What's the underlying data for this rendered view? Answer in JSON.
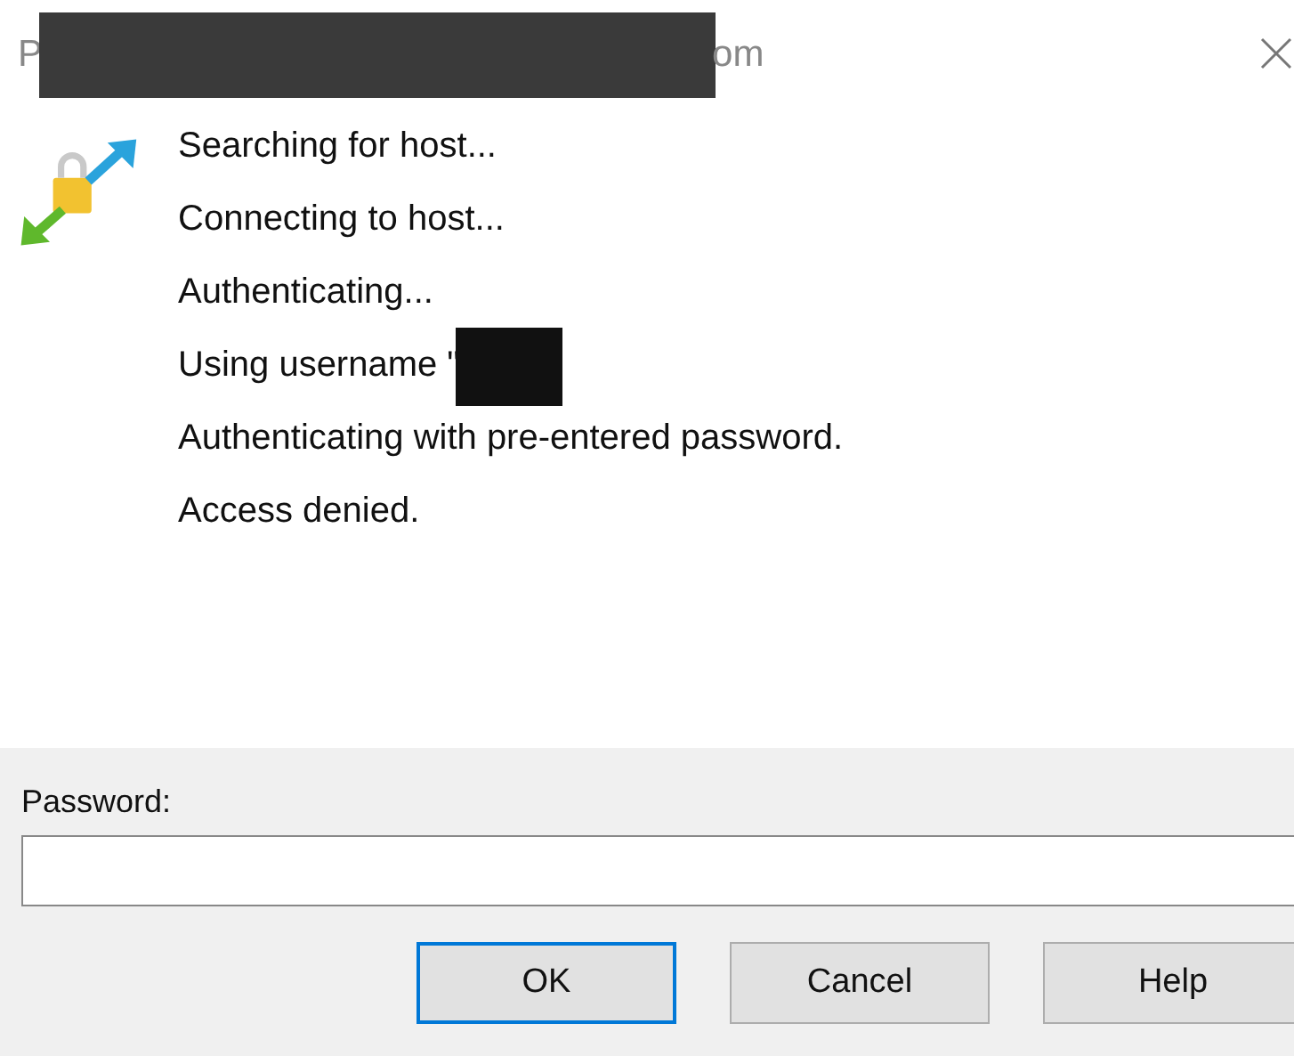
{
  "window": {
    "title_start": "P",
    "title_end": "om",
    "title_redacted": true
  },
  "log": [
    {
      "text": "Searching for host...",
      "redacted_after": false
    },
    {
      "text": "Connecting to host...",
      "redacted_after": false
    },
    {
      "text": "Authenticating...",
      "redacted_after": false
    },
    {
      "text": "Using username \"",
      "redacted_after": true
    },
    {
      "text": "Authenticating with pre-entered password.",
      "redacted_after": false
    },
    {
      "text": "Access denied.",
      "redacted_after": false
    }
  ],
  "password": {
    "label": "Password:"
  },
  "buttons": [
    {
      "label": "OK",
      "default": true
    },
    {
      "label": "Cancel",
      "default": false
    },
    {
      "label": "Help",
      "default": false
    }
  ]
}
